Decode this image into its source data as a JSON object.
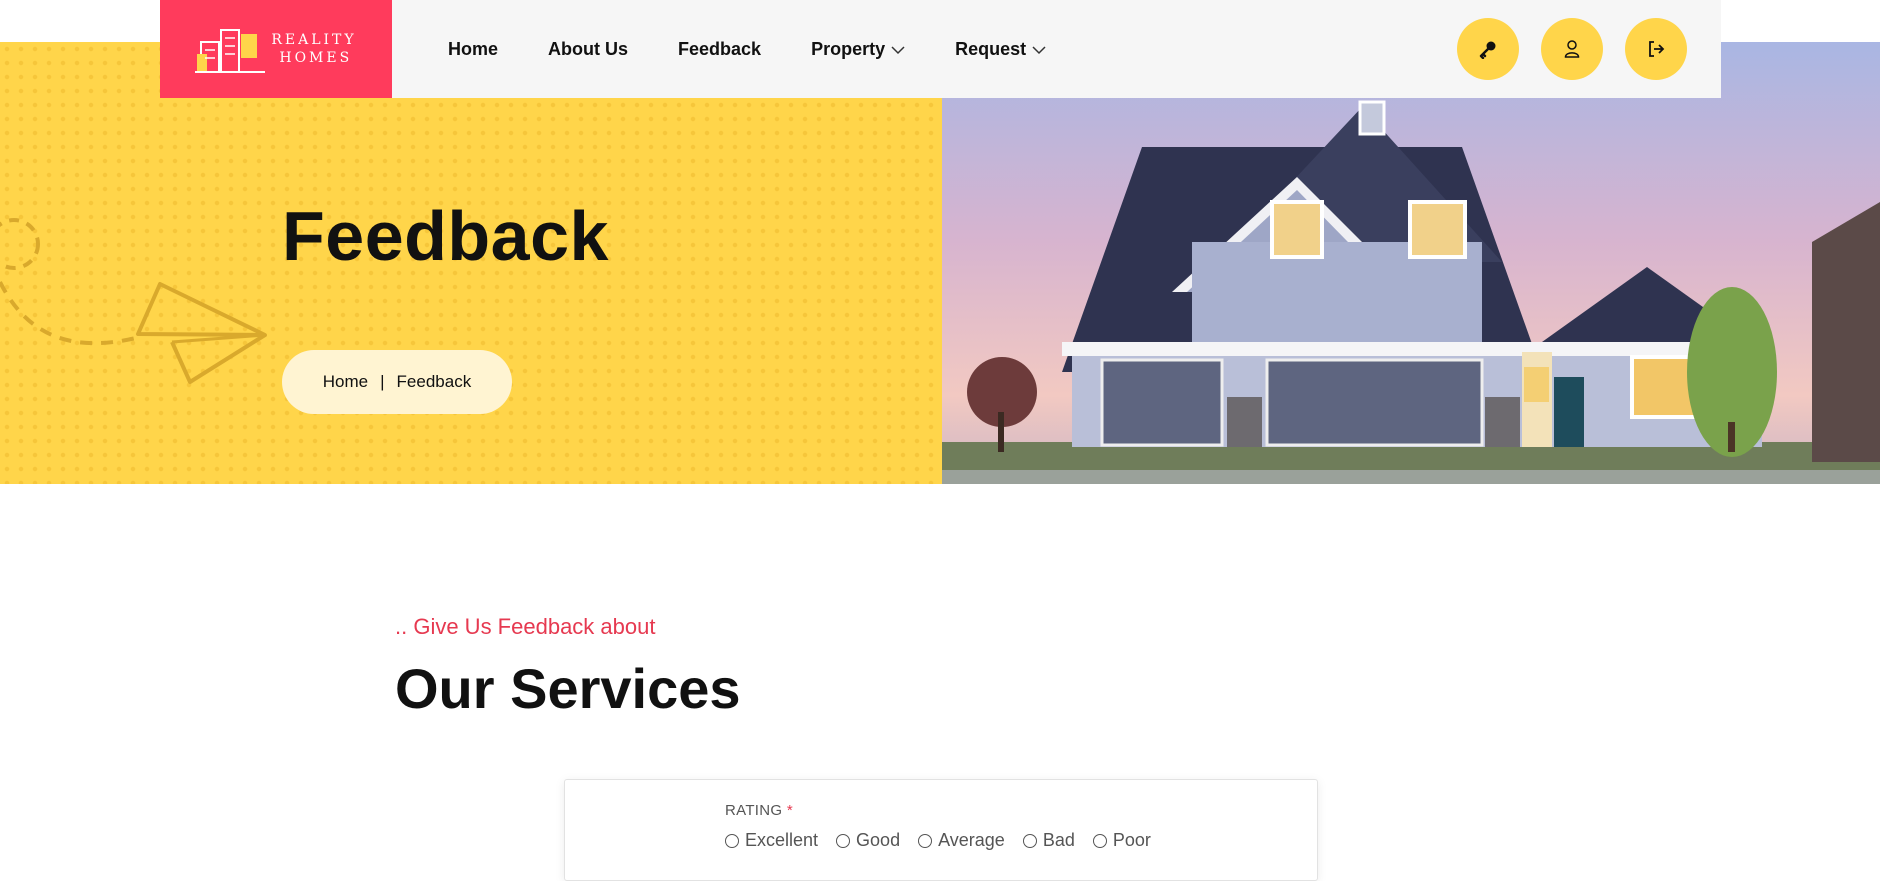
{
  "header": {
    "logo": {
      "line1": "REALITY",
      "line2": "HOMES"
    },
    "nav": [
      {
        "label": "Home",
        "has_dropdown": false
      },
      {
        "label": "About Us",
        "has_dropdown": false
      },
      {
        "label": "Feedback",
        "has_dropdown": false
      },
      {
        "label": "Property",
        "has_dropdown": true
      },
      {
        "label": "Request",
        "has_dropdown": true
      }
    ],
    "actions": [
      {
        "icon": "key-icon"
      },
      {
        "icon": "user-icon"
      },
      {
        "icon": "logout-icon"
      }
    ]
  },
  "hero": {
    "title": "Feedback",
    "breadcrumb": {
      "home": "Home",
      "separator": "|",
      "current": "Feedback"
    }
  },
  "section": {
    "eyebrow": ".. Give Us Feedback about",
    "title": "Our Services"
  },
  "form": {
    "rating": {
      "label": "RATING",
      "required_mark": "*",
      "options": [
        "Excellent",
        "Good",
        "Average",
        "Bad",
        "Poor"
      ]
    }
  },
  "colors": {
    "accent_yellow": "#ffd54a",
    "brand_pink": "#ff3b5c",
    "eyebrow_red": "#e63950"
  }
}
